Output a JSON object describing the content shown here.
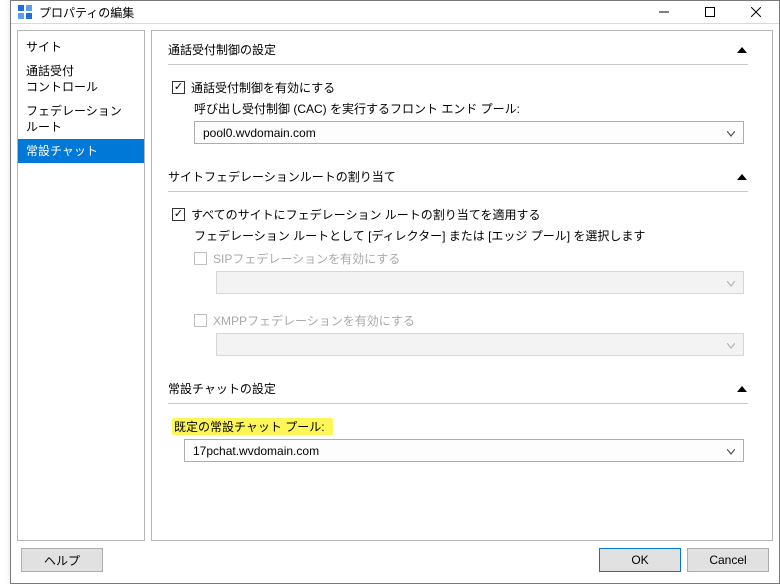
{
  "window": {
    "title": "プロパティの編集"
  },
  "sidebar": {
    "items": [
      {
        "label": "サイト"
      },
      {
        "label": "通話受付\nコントロール"
      },
      {
        "label": "フェデレーション ルート"
      },
      {
        "label": "常設チャット",
        "selected": true
      }
    ]
  },
  "section_cac": {
    "title": "通話受付制御の設定",
    "enable_label": "通話受付制御を有効にする",
    "enable_checked": true,
    "pool_label": "呼び出し受付制御 (CAC) を実行するフロント エンド プール:",
    "pool_value": "pool0.wvdomain.com"
  },
  "section_fed": {
    "title": "サイトフェデレーションルートの割り当て",
    "applyall_label": "すべてのサイトにフェデレーション ルートの割り当てを適用する",
    "applyall_checked": true,
    "route_hint": "フェデレーション ルートとして [ディレクター] または [エッジ プール] を選択します",
    "sip_enable_label": "SIPフェデレーションを有効にする",
    "sip_enable_checked": false,
    "sip_pool_value": "",
    "xmpp_enable_label": "XMPPフェデレーションを有効にする",
    "xmpp_enable_checked": false,
    "xmpp_pool_value": ""
  },
  "section_chat": {
    "title": "常設チャットの設定",
    "default_pool_label": "既定の常設チャット プール:",
    "default_pool_value": "17pchat.wvdomain.com"
  },
  "buttons": {
    "help": "ヘルプ",
    "ok": "OK",
    "cancel": "Cancel"
  }
}
